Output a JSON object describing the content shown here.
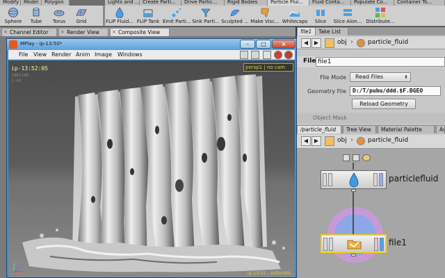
{
  "shelf": {
    "tabs": [
      {
        "label": "Modify"
      },
      {
        "label": "Model"
      },
      {
        "label": "Polygon"
      },
      {
        "label": "Lights and ..."
      },
      {
        "label": "Create Parti..."
      },
      {
        "label": "Drive Partic..."
      },
      {
        "label": "Rigid Bodies"
      },
      {
        "label": "Particle Flui...",
        "active": true
      },
      {
        "label": "Fluid Conta..."
      },
      {
        "label": "Populate Co..."
      },
      {
        "label": "Container To..."
      }
    ],
    "tools": [
      {
        "label": "Sphere",
        "icon": "sphere-icon"
      },
      {
        "label": "Tube",
        "icon": "tube-icon"
      },
      {
        "label": "Torus",
        "icon": "torus-icon"
      },
      {
        "label": "Grid",
        "icon": "grid-icon"
      },
      {
        "label": "FLIP Fluid...",
        "icon": "flip-fluid-icon"
      },
      {
        "label": "FLIP Tank",
        "icon": "flip-tank-icon"
      },
      {
        "label": "Emit Parti...",
        "icon": "emit-particle-icon"
      },
      {
        "label": "Sink Parti...",
        "icon": "sink-particle-icon"
      },
      {
        "label": "Sculpted ...",
        "icon": "sculpted-icon"
      },
      {
        "label": "Make Visc...",
        "icon": "make-viscous-icon"
      },
      {
        "label": "Whitecaps",
        "icon": "whitecaps-icon"
      },
      {
        "label": "Slice",
        "icon": "slice-icon"
      },
      {
        "label": "Slice Alon...",
        "icon": "slice-along-icon"
      },
      {
        "label": "Distribute...",
        "icon": "distribute-icon"
      }
    ]
  },
  "left_tabs": [
    {
      "label": "Channel Editor"
    },
    {
      "label": "Render View"
    },
    {
      "label": "Composite View",
      "active": true
    }
  ],
  "mplay": {
    "title": "MPlay - ip-13:50*",
    "menus": [
      "File",
      "View",
      "Render",
      "Anim",
      "Image",
      "Windows"
    ],
    "hud_time": "ip-13:52:05",
    "hud_cam": "persp1 | no cam",
    "hud_footer": "ip-13:52 - 640x480",
    "hud_small_1": "186x140",
    "hud_small_2": "1:49"
  },
  "right_top_tabs": [
    {
      "label": "file1",
      "active": true
    },
    {
      "label": "Take List"
    }
  ],
  "path_top": {
    "root": "obj",
    "node": "particle_fluid"
  },
  "param_header": {
    "type": "File",
    "name": "file1"
  },
  "params": {
    "file_mode_label": "File Mode",
    "file_mode_value": "Read Files",
    "geometry_file_label": "Geometry File",
    "geometry_file_value": "D:/T/pubu/ddd.$F.BGEO",
    "reload_label": "Reload Geometry",
    "object_mask_label": "Object Mask"
  },
  "right_mid_tabs": [
    {
      "label": "/particle_fluid",
      "active": true
    },
    {
      "label": "Tree View"
    },
    {
      "label": "Material Palette"
    },
    {
      "label": "As"
    }
  ],
  "path_mid": {
    "root": "obj",
    "node": "particle_fluid"
  },
  "nodes": {
    "particlefluid": "particlefluid",
    "file1": "file1"
  },
  "colors": {
    "mplay_blue": "#3b8fd4",
    "node_selected": "#f0d020",
    "halo_blue": "#8da8e6",
    "halo_pink": "#c79ad6"
  }
}
